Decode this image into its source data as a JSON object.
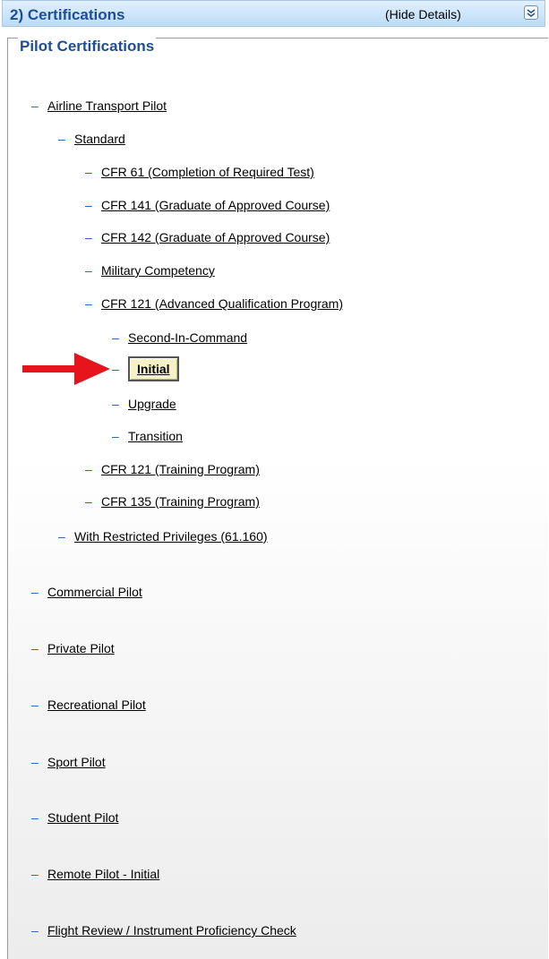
{
  "header": {
    "title": "2) Certifications",
    "hide_details": "(Hide Details)",
    "collapse_icon": "chevron-double-up-icon"
  },
  "panel": {
    "legend": "Pilot Certifications"
  },
  "tree": {
    "atp": "Airline Transport Pilot",
    "standard": "Standard",
    "cfr61": "CFR 61 (Completion of Required Test)",
    "cfr141": "CFR 141 (Graduate of Approved Course)",
    "cfr142": "CFR 142 (Graduate of Approved Course)",
    "military": "Military Competency",
    "cfr121aqp": "CFR 121 (Advanced Qualification Program)",
    "sic": "Second-In-Command",
    "initial": "Initial",
    "upgrade": "Upgrade",
    "transition": "Transition",
    "cfr121tp": "CFR 121 (Training Program)",
    "cfr135tp": "CFR 135 (Training Program)",
    "restricted": "With Restricted Privileges (61.160)",
    "commercial": "Commercial Pilot",
    "private": "Private Pilot",
    "recreational": "Recreational Pilot",
    "sport": "Sport Pilot",
    "student": "Student Pilot",
    "remote": "Remote Pilot - Initial",
    "flight_review": "Flight Review / Instrument Proficiency Check"
  },
  "dash_glyph": "–",
  "colors": {
    "header_text": "#1f4e96",
    "dash": "#1f5fb0",
    "selected_bg": "#f6f2c6",
    "arrow": "#e8141b"
  },
  "selected_item": "Initial"
}
